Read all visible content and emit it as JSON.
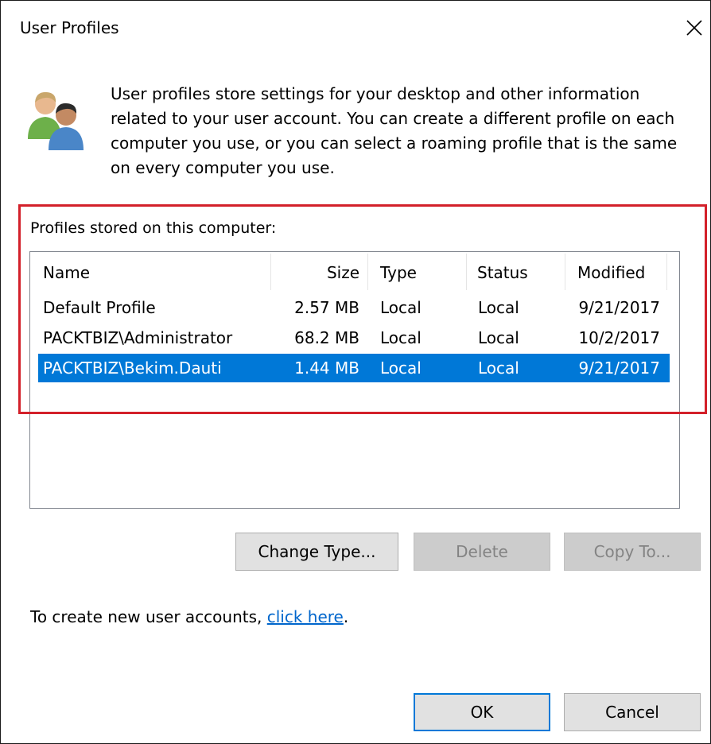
{
  "window": {
    "title": "User Profiles",
    "close_symbol": "✕"
  },
  "description": "User profiles store settings for your desktop and other information related to your user account. You can create a different profile on each computer you use, or you can select a roaming profile that is the same on every computer you use.",
  "profiles": {
    "label": "Profiles stored on this computer:",
    "columns": [
      "Name",
      "Size",
      "Type",
      "Status",
      "Modified"
    ],
    "rows": [
      {
        "name": "Default Profile",
        "size": "2.57 MB",
        "type": "Local",
        "status": "Local",
        "modified": "9/21/2017",
        "selected": false
      },
      {
        "name": "PACKTBIZ\\Administrator",
        "size": "68.2 MB",
        "type": "Local",
        "status": "Local",
        "modified": "10/2/2017",
        "selected": false
      },
      {
        "name": "PACKTBIZ\\Bekim.Dauti",
        "size": "1.44 MB",
        "type": "Local",
        "status": "Local",
        "modified": "9/21/2017",
        "selected": true
      }
    ]
  },
  "buttons": {
    "change_type": "Change Type...",
    "delete": "Delete",
    "copy_to": "Copy To...",
    "ok": "OK",
    "cancel": "Cancel"
  },
  "footer": {
    "prefix": "To create new user accounts, ",
    "link": "click here",
    "suffix": "."
  },
  "colors": {
    "selection": "#0078d7",
    "highlight_border": "#d3202a",
    "link": "#0066cc"
  }
}
